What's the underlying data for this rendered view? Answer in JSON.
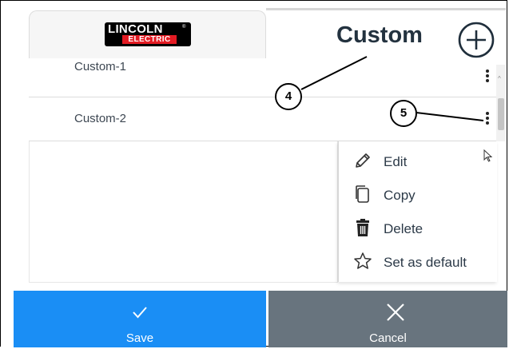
{
  "header": {
    "logo": {
      "line1": "LINCOLN",
      "line2": "ELECTRIC",
      "registered": "®"
    },
    "title": "Custom",
    "add_icon": "plus-circle-icon"
  },
  "list": {
    "items": [
      {
        "label": "Custom-1"
      },
      {
        "label": "Custom-2"
      }
    ]
  },
  "menu": {
    "items": [
      {
        "label": "Edit",
        "icon": "pencil-icon"
      },
      {
        "label": "Copy",
        "icon": "copy-icon"
      },
      {
        "label": "Delete",
        "icon": "trash-icon"
      },
      {
        "label": "Set as default",
        "icon": "star-icon"
      }
    ]
  },
  "callouts": {
    "a": "4",
    "b": "5"
  },
  "footer": {
    "save_label": "Save",
    "cancel_label": "Cancel",
    "save_icon": "check-icon",
    "cancel_icon": "close-icon"
  },
  "colors": {
    "save": "#1a8ef5",
    "cancel": "#68747e",
    "brand_red": "#e31b23",
    "title": "#23323f"
  }
}
